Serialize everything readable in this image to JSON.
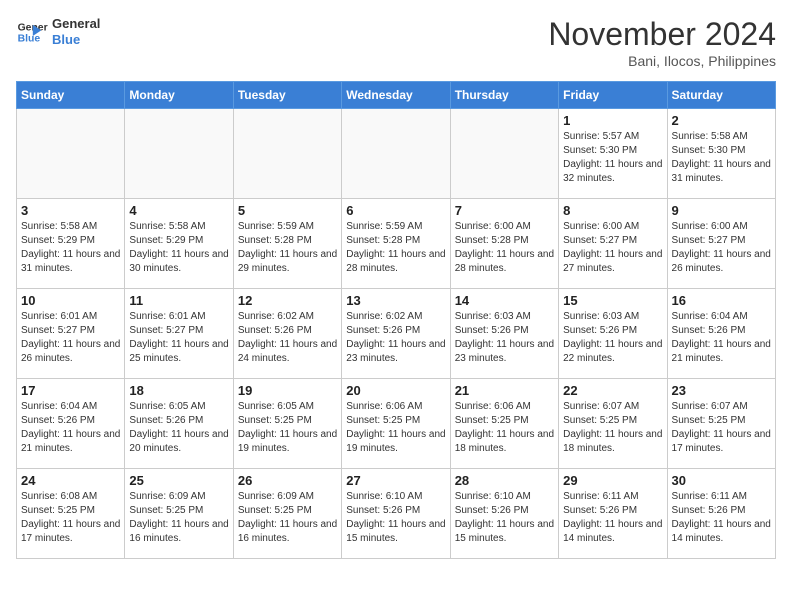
{
  "header": {
    "logo_line1": "General",
    "logo_line2": "Blue",
    "month": "November 2024",
    "location": "Bani, Ilocos, Philippines"
  },
  "weekdays": [
    "Sunday",
    "Monday",
    "Tuesday",
    "Wednesday",
    "Thursday",
    "Friday",
    "Saturday"
  ],
  "weeks": [
    [
      {
        "day": "",
        "info": ""
      },
      {
        "day": "",
        "info": ""
      },
      {
        "day": "",
        "info": ""
      },
      {
        "day": "",
        "info": ""
      },
      {
        "day": "",
        "info": ""
      },
      {
        "day": "1",
        "info": "Sunrise: 5:57 AM\nSunset: 5:30 PM\nDaylight: 11 hours and 32 minutes."
      },
      {
        "day": "2",
        "info": "Sunrise: 5:58 AM\nSunset: 5:30 PM\nDaylight: 11 hours and 31 minutes."
      }
    ],
    [
      {
        "day": "3",
        "info": "Sunrise: 5:58 AM\nSunset: 5:29 PM\nDaylight: 11 hours and 31 minutes."
      },
      {
        "day": "4",
        "info": "Sunrise: 5:58 AM\nSunset: 5:29 PM\nDaylight: 11 hours and 30 minutes."
      },
      {
        "day": "5",
        "info": "Sunrise: 5:59 AM\nSunset: 5:28 PM\nDaylight: 11 hours and 29 minutes."
      },
      {
        "day": "6",
        "info": "Sunrise: 5:59 AM\nSunset: 5:28 PM\nDaylight: 11 hours and 28 minutes."
      },
      {
        "day": "7",
        "info": "Sunrise: 6:00 AM\nSunset: 5:28 PM\nDaylight: 11 hours and 28 minutes."
      },
      {
        "day": "8",
        "info": "Sunrise: 6:00 AM\nSunset: 5:27 PM\nDaylight: 11 hours and 27 minutes."
      },
      {
        "day": "9",
        "info": "Sunrise: 6:00 AM\nSunset: 5:27 PM\nDaylight: 11 hours and 26 minutes."
      }
    ],
    [
      {
        "day": "10",
        "info": "Sunrise: 6:01 AM\nSunset: 5:27 PM\nDaylight: 11 hours and 26 minutes."
      },
      {
        "day": "11",
        "info": "Sunrise: 6:01 AM\nSunset: 5:27 PM\nDaylight: 11 hours and 25 minutes."
      },
      {
        "day": "12",
        "info": "Sunrise: 6:02 AM\nSunset: 5:26 PM\nDaylight: 11 hours and 24 minutes."
      },
      {
        "day": "13",
        "info": "Sunrise: 6:02 AM\nSunset: 5:26 PM\nDaylight: 11 hours and 23 minutes."
      },
      {
        "day": "14",
        "info": "Sunrise: 6:03 AM\nSunset: 5:26 PM\nDaylight: 11 hours and 23 minutes."
      },
      {
        "day": "15",
        "info": "Sunrise: 6:03 AM\nSunset: 5:26 PM\nDaylight: 11 hours and 22 minutes."
      },
      {
        "day": "16",
        "info": "Sunrise: 6:04 AM\nSunset: 5:26 PM\nDaylight: 11 hours and 21 minutes."
      }
    ],
    [
      {
        "day": "17",
        "info": "Sunrise: 6:04 AM\nSunset: 5:26 PM\nDaylight: 11 hours and 21 minutes."
      },
      {
        "day": "18",
        "info": "Sunrise: 6:05 AM\nSunset: 5:26 PM\nDaylight: 11 hours and 20 minutes."
      },
      {
        "day": "19",
        "info": "Sunrise: 6:05 AM\nSunset: 5:25 PM\nDaylight: 11 hours and 19 minutes."
      },
      {
        "day": "20",
        "info": "Sunrise: 6:06 AM\nSunset: 5:25 PM\nDaylight: 11 hours and 19 minutes."
      },
      {
        "day": "21",
        "info": "Sunrise: 6:06 AM\nSunset: 5:25 PM\nDaylight: 11 hours and 18 minutes."
      },
      {
        "day": "22",
        "info": "Sunrise: 6:07 AM\nSunset: 5:25 PM\nDaylight: 11 hours and 18 minutes."
      },
      {
        "day": "23",
        "info": "Sunrise: 6:07 AM\nSunset: 5:25 PM\nDaylight: 11 hours and 17 minutes."
      }
    ],
    [
      {
        "day": "24",
        "info": "Sunrise: 6:08 AM\nSunset: 5:25 PM\nDaylight: 11 hours and 17 minutes."
      },
      {
        "day": "25",
        "info": "Sunrise: 6:09 AM\nSunset: 5:25 PM\nDaylight: 11 hours and 16 minutes."
      },
      {
        "day": "26",
        "info": "Sunrise: 6:09 AM\nSunset: 5:25 PM\nDaylight: 11 hours and 16 minutes."
      },
      {
        "day": "27",
        "info": "Sunrise: 6:10 AM\nSunset: 5:26 PM\nDaylight: 11 hours and 15 minutes."
      },
      {
        "day": "28",
        "info": "Sunrise: 6:10 AM\nSunset: 5:26 PM\nDaylight: 11 hours and 15 minutes."
      },
      {
        "day": "29",
        "info": "Sunrise: 6:11 AM\nSunset: 5:26 PM\nDaylight: 11 hours and 14 minutes."
      },
      {
        "day": "30",
        "info": "Sunrise: 6:11 AM\nSunset: 5:26 PM\nDaylight: 11 hours and 14 minutes."
      }
    ]
  ]
}
